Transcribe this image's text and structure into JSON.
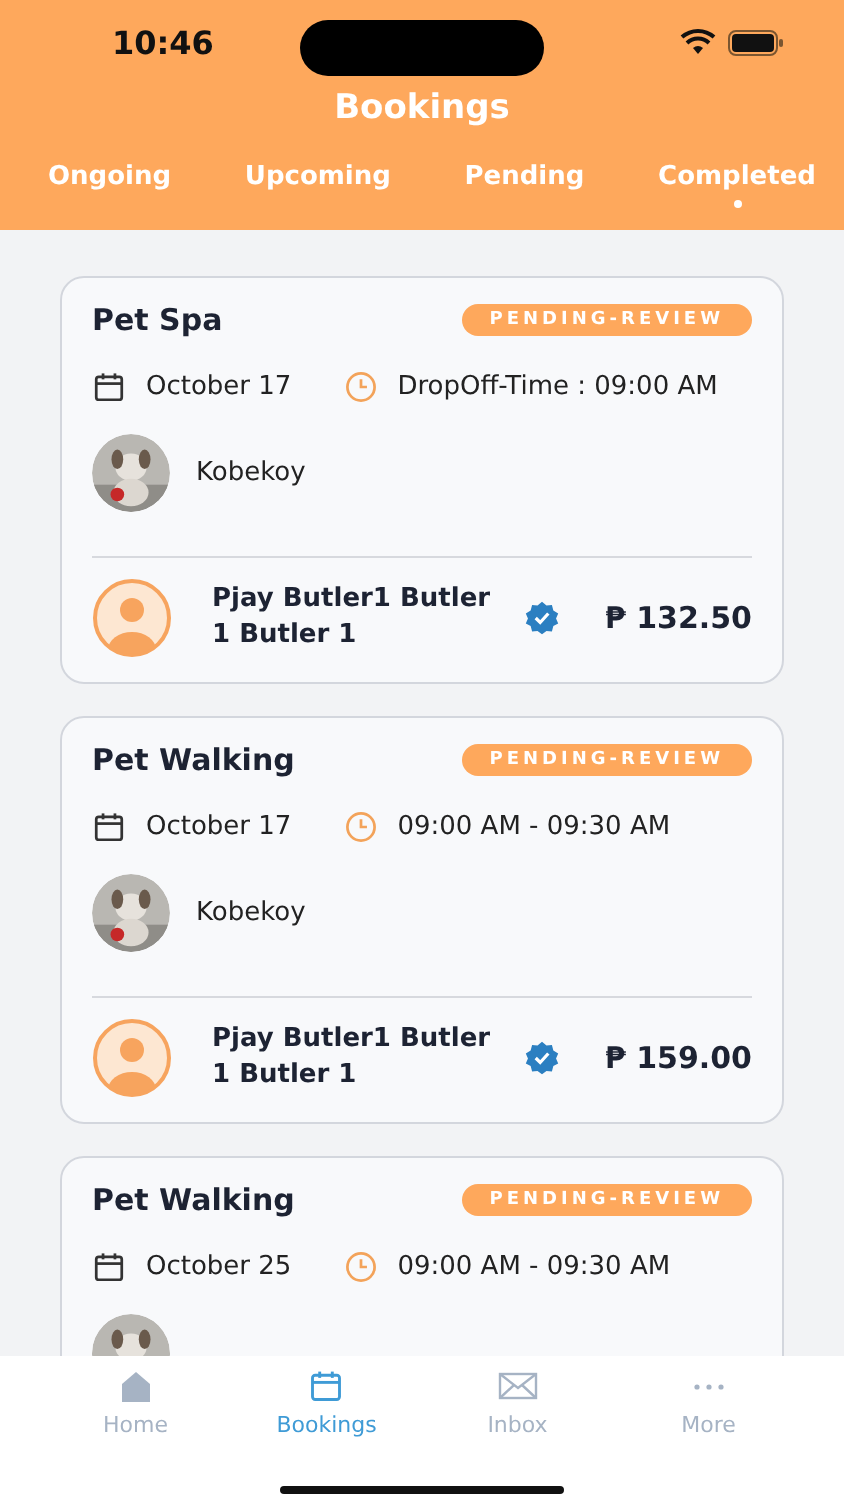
{
  "status_bar": {
    "time": "10:46"
  },
  "title": "Bookings",
  "tabs": [
    {
      "label": "Ongoing",
      "selected": false
    },
    {
      "label": "Upcoming",
      "selected": false
    },
    {
      "label": "Pending",
      "selected": false
    },
    {
      "label": "Completed",
      "selected": true
    }
  ],
  "bookings": [
    {
      "service": "Pet Spa",
      "status": "PENDING-REVIEW",
      "date": "October 17",
      "time": "DropOff-Time : 09:00 AM",
      "pet": "Kobekoy",
      "provider": "Pjay Butler1 Butler 1 Butler 1",
      "verified": true,
      "price": "₱ 132.50"
    },
    {
      "service": "Pet Walking",
      "status": "PENDING-REVIEW",
      "date": "October 17",
      "time": "09:00 AM - 09:30 AM",
      "pet": "Kobekoy",
      "provider": "Pjay Butler1 Butler 1 Butler 1",
      "verified": true,
      "price": "₱ 159.00"
    },
    {
      "service": "Pet Walking",
      "status": "PENDING-REVIEW",
      "date": "October 25",
      "time": "09:00 AM - 09:30 AM"
    }
  ],
  "nav": [
    {
      "label": "Home",
      "kind": "home",
      "selected": false
    },
    {
      "label": "Bookings",
      "kind": "calendar",
      "selected": true
    },
    {
      "label": "Inbox",
      "kind": "mail",
      "selected": false
    },
    {
      "label": "More",
      "kind": "more",
      "selected": false
    }
  ]
}
